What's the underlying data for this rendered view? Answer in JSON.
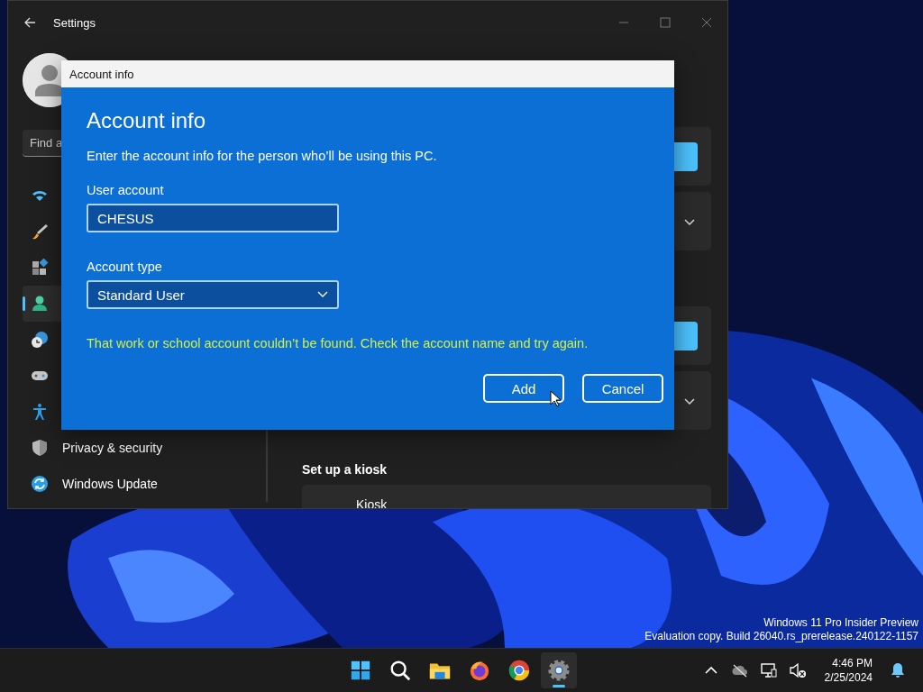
{
  "settings_window": {
    "title": "Settings",
    "search": {
      "placeholder": "Find a"
    },
    "nav_items": [
      {
        "selected": false
      },
      {
        "selected": false
      },
      {
        "selected": false
      },
      {
        "selected": true
      },
      {
        "selected": false
      },
      {
        "selected": false
      },
      {
        "selected": false
      },
      {
        "label": "Privacy & security",
        "selected": false
      },
      {
        "label": "Windows Update",
        "selected": false
      }
    ],
    "section_heading": "Set up a kiosk",
    "kiosk_card": {
      "label": "Kiosk"
    }
  },
  "dialog": {
    "title": "Account info",
    "heading": "Account info",
    "description": "Enter the account info for the person who’ll be using this PC.",
    "fields": [
      {
        "kind": "text",
        "label": "User account",
        "value": "CHESUS"
      },
      {
        "kind": "dropdown",
        "label": "Account type",
        "value": "Standard User"
      }
    ],
    "error": "That work or school account couldn’t be found. Check the account name and try again.",
    "buttons": [
      "Add",
      "Cancel"
    ]
  },
  "watermark": [
    "Windows 11 Pro Insider Preview",
    "Evaluation copy. Build 26040.rs_prerelease.240122-1157"
  ],
  "taskbar": {
    "apps": [
      {
        "active": false
      },
      {
        "active": false
      },
      {
        "active": false
      },
      {
        "active": false
      },
      {
        "active": false
      },
      {
        "active": true
      }
    ],
    "time": "4:46 PM",
    "date": "2/25/2024"
  }
}
